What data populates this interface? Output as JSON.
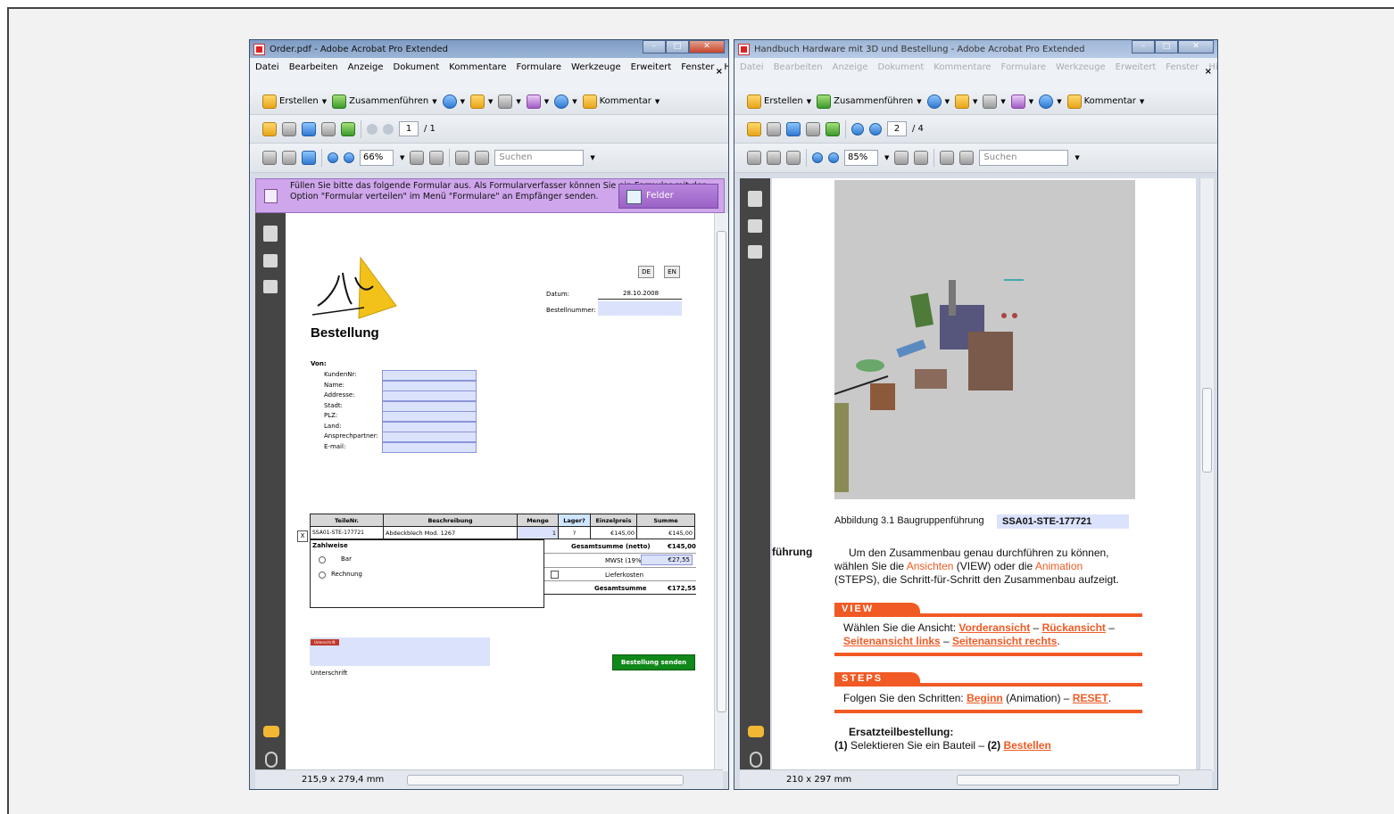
{
  "left_window": {
    "title": "Order.pdf - Adobe Acrobat Pro Extended",
    "menu": [
      "Datei",
      "Bearbeiten",
      "Anzeige",
      "Dokument",
      "Kommentare",
      "Formulare",
      "Werkzeuge",
      "Erweitert",
      "Fenster",
      "Hilfe"
    ],
    "toolbar1": {
      "create": "Erstellen",
      "merge": "Zusammenführen",
      "comment": "Kommentar"
    },
    "page_current": "1",
    "page_total": "/ 1",
    "zoom": "66%",
    "search_placeholder": "Suchen",
    "form_message": "Füllen Sie bitte das folgende Formular aus. Als Formularverfasser können Sie ein Formular mit der Option \"Formular verteilen\" im Menü \"Formulare\" an Empfänger senden.",
    "highlight_button": "Felder markieren",
    "page_size": "215,9 x 279,4 mm",
    "doc": {
      "heading": "Bestellung",
      "lang_de": "DE",
      "lang_en": "EN",
      "datum_label": "Datum:",
      "datum_value": "28.10.2008",
      "bestellnummer_label": "Bestellnummer:",
      "von_label": "Von:",
      "fields": [
        "KundenNr:",
        "Name:",
        "Addresse:",
        "Stadt:",
        "PLZ:",
        "Land:",
        "Ansprechpartner:",
        "E-mail:"
      ],
      "table_headers": [
        "TeileNr.",
        "Beschreibung",
        "Menge",
        "Lager?",
        "Einzelpreis",
        "Summe"
      ],
      "row": {
        "x": "X",
        "teilenr": "SSA01-STE-177721",
        "beschreibung": "Abdeckblech Mod. 1267",
        "menge": "1",
        "lager": "?",
        "einzelpreis": "€145,00",
        "summe": "€145,00"
      },
      "zahlweise_label": "Zahlweise",
      "pay_options": [
        "Bar",
        "Rechnung"
      ],
      "gesamt_netto_label": "Gesamtsumme (netto)",
      "gesamt_netto_value": "€145,00",
      "mwst_label": "MWSt (19%)",
      "mwst_value": "€27,55",
      "liefer_label": "Lieferkosten",
      "gesamt_label": "Gesamtsumme",
      "gesamt_value": "€172,55",
      "signature_tag": "Unterschrift",
      "signature_label": "Unterschrift",
      "send_button": "Bestellung senden"
    }
  },
  "right_window": {
    "title": "Handbuch Hardware mit 3D und Bestellung - Adobe Acrobat Pro Extended",
    "menu": [
      "Datei",
      "Bearbeiten",
      "Anzeige",
      "Dokument",
      "Kommentare",
      "Formulare",
      "Werkzeuge",
      "Erweitert",
      "Fenster",
      "Hilfe"
    ],
    "toolbar1": {
      "create": "Erstellen",
      "merge": "Zusammenführen",
      "comment": "Kommentar"
    },
    "page_current": "2",
    "page_total": "/ 4",
    "zoom": "85%",
    "search_placeholder": "Suchen",
    "page_size": "210 x 297 mm",
    "doc": {
      "caption": "Abbildung 3.1 Baugruppenführung",
      "part_no": "SSA01-STE-177721",
      "side_heading": "führung",
      "para1_a": "Um den Zusammenbau genau durchführen zu können,",
      "para1_b_pre": "wählen Sie die ",
      "para1_ansichten": "Ansichten",
      "para1_b_mid": " (VIEW) oder die ",
      "para1_animation": "Animation",
      "para1_c": "(STEPS), die Schritt-für-Schritt den Zusammenbau aufzeigt.",
      "view_tag": "VIEW",
      "view_text": "Wählen Sie die Ansicht: ",
      "view_links": [
        "Vorderansicht",
        "Rückansicht",
        "Seitenansicht links",
        "Seitenansicht rechts"
      ],
      "dash": " – ",
      "dot": ".",
      "steps_tag": "STEPS",
      "steps_text": "Folgen Sie den Schritten: ",
      "steps_begin": "Beginn",
      "steps_anim": " (Animation) – ",
      "steps_reset": "RESET",
      "spare_title": "Ersatzteilbestellung:",
      "spare_1": "(1)",
      "spare_1_text": " Selektieren Sie ein Bauteil – ",
      "spare_2": "(2)",
      "spare_order": "Bestellen"
    }
  },
  "colors": {
    "accent": "#f15a24",
    "form_bar": "#cfa6ec",
    "send_button": "#11881a",
    "field": "#dbe2fb"
  }
}
